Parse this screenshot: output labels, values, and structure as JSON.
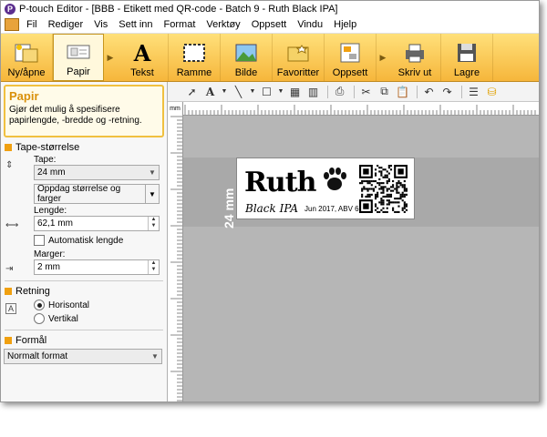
{
  "titlebar": {
    "app_icon": "P",
    "title": "P-touch Editor - [BBB - Etikett med QR-code - Batch 9 - Ruth Black IPA]"
  },
  "menu": [
    "Fil",
    "Rediger",
    "Vis",
    "Sett inn",
    "Format",
    "Verktøy",
    "Oppsett",
    "Vindu",
    "Hjelp"
  ],
  "ribbon": {
    "buttons": [
      {
        "label": "Ny/åpne",
        "icon": "new-open-icon"
      },
      {
        "label": "Papir",
        "icon": "paper-icon",
        "active": true
      },
      {
        "label": "Tekst",
        "icon": "text-icon"
      },
      {
        "label": "Ramme",
        "icon": "frame-icon"
      },
      {
        "label": "Bilde",
        "icon": "picture-icon"
      },
      {
        "label": "Favoritter",
        "icon": "favorites-icon"
      },
      {
        "label": "Oppsett",
        "icon": "layout-icon"
      },
      {
        "label": "Skriv ut",
        "icon": "print-icon"
      },
      {
        "label": "Lagre",
        "icon": "save-icon"
      }
    ]
  },
  "help": {
    "title": "Papir",
    "text": "Gjør det mulig å spesifisere papirlengde, -bredde og -retning."
  },
  "tape_size": {
    "section": "Tape-størrelse",
    "tape_label": "Tape:",
    "tape_value": "24 mm",
    "detect_button": "Oppdag størrelse og farger",
    "length_label": "Lengde:",
    "length_value": "62,1 mm",
    "auto_length_label": "Automatisk lengde",
    "margin_label": "Marger:",
    "margin_value": "2 mm"
  },
  "orientation": {
    "section": "Retning",
    "horizontal": "Horisontal",
    "vertical": "Vertikal",
    "selected": "Horisontal"
  },
  "format": {
    "section": "Formål",
    "value": "Normalt format"
  },
  "ruler": {
    "unit": "mm"
  },
  "canvas": {
    "tape_size_label": "24 mm",
    "label": {
      "title": "Ruth",
      "subtitle": "Black IPA",
      "detail": "Jun 2017, ABV 6,3%,"
    }
  },
  "colors": {
    "ribbon": "#f6b63b",
    "accent": "#f0a010",
    "canvas": "#b6b6b6"
  }
}
